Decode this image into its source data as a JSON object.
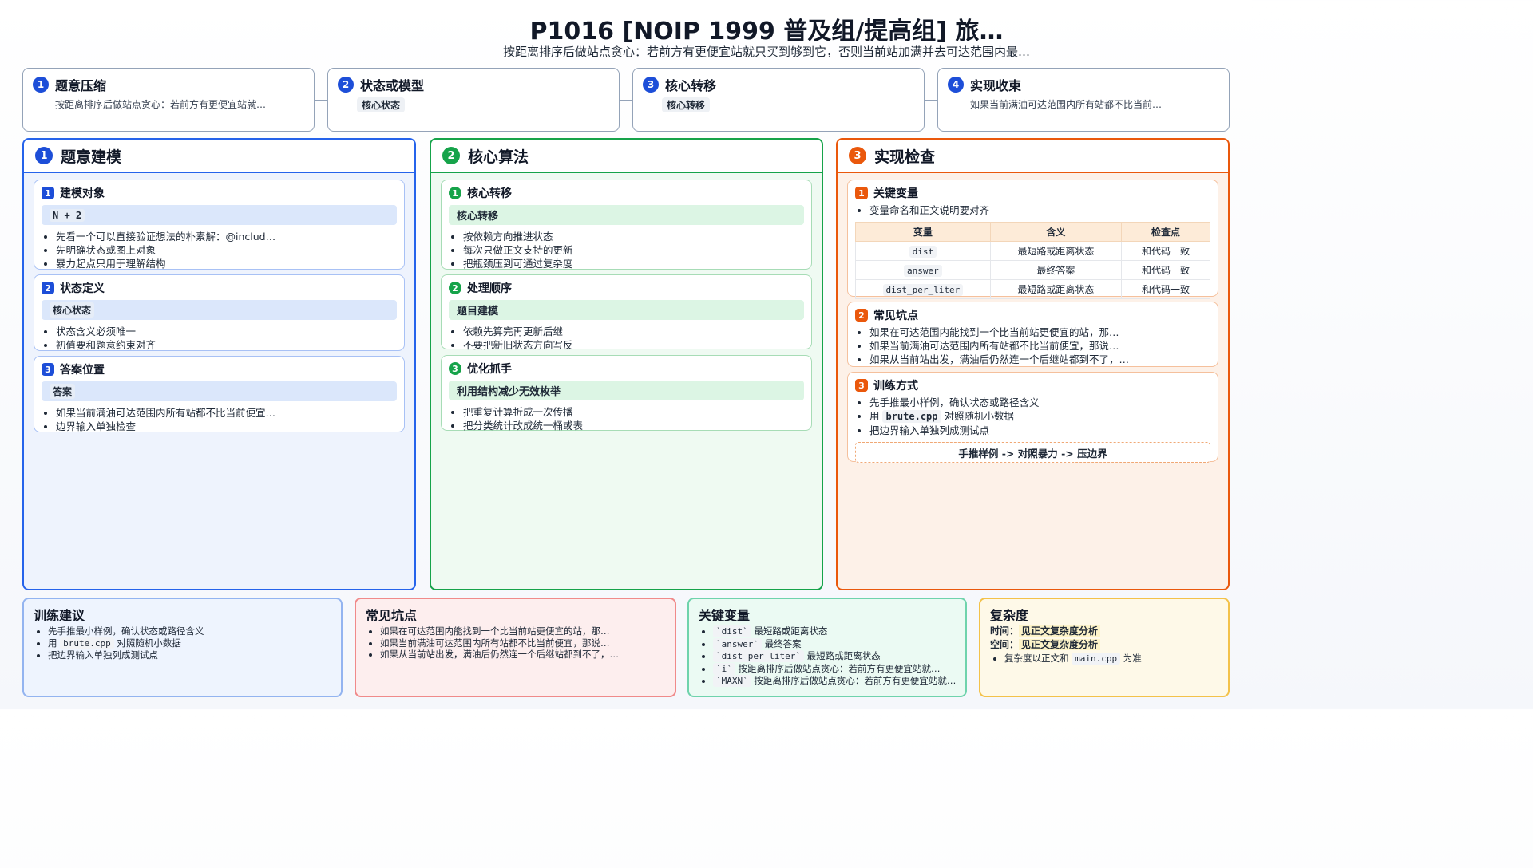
{
  "header": {
    "title": "P1016 [NOIP 1999 普及组/提高组] 旅…",
    "subtitle": "按距离排序后做站点贪心：若前方有更便宜站就只买到够到它，否则当前站加满并去可达范围内最…"
  },
  "steps": [
    {
      "num": "1",
      "title": "题意压缩",
      "desc": "按距离排序后做站点贪心：若前方有更便宜站就…"
    },
    {
      "num": "2",
      "title": "状态或模型",
      "chip": "核心状态"
    },
    {
      "num": "3",
      "title": "核心转移",
      "chip": "核心转移"
    },
    {
      "num": "4",
      "title": "实现收束",
      "desc": "如果当前满油可达范围内所有站都不比当前…"
    }
  ],
  "columns": {
    "modeling": {
      "num": "1",
      "title": "题意建模",
      "cards": [
        {
          "num": "1",
          "title": "建模对象",
          "chip": "N + 2",
          "bullets": [
            "先看一个可以直接验证想法的朴素解：@includ…",
            "先明确状态或图上对象",
            "暴力起点只用于理解结构"
          ]
        },
        {
          "num": "2",
          "title": "状态定义",
          "chip": "核心状态",
          "bullets": [
            "状态含义必须唯一",
            "初值要和题意约束对齐"
          ]
        },
        {
          "num": "3",
          "title": "答案位置",
          "chip": "答案",
          "bullets": [
            "如果当前满油可达范围内所有站都不比当前便宜…",
            "边界输入单独检查"
          ]
        }
      ]
    },
    "algorithm": {
      "num": "2",
      "title": "核心算法",
      "cards": [
        {
          "num": "1",
          "title": "核心转移",
          "chip": "核心转移",
          "bullets": [
            "按依赖方向推进状态",
            "每次只做正文支持的更新",
            "把瓶颈压到可通过复杂度"
          ]
        },
        {
          "num": "2",
          "title": "处理顺序",
          "chip": "题目建模",
          "bullets": [
            "依赖先算完再更新后继",
            "不要把新旧状态方向写反"
          ]
        },
        {
          "num": "3",
          "title": "优化抓手",
          "chip": "利用结构减少无效枚举",
          "bullets": [
            "把重复计算折成一次传播",
            "把分类统计改成统一桶或表"
          ]
        }
      ]
    },
    "implementation": {
      "num": "3",
      "title": "实现检查",
      "vars_card": {
        "num": "1",
        "title": "关键变量",
        "bullet": "变量命名和正文说明要对齐",
        "headers": [
          "变量",
          "含义",
          "检查点"
        ],
        "rows": [
          [
            "dist",
            "最短路或距离状态",
            "和代码一致"
          ],
          [
            "answer",
            "最终答案",
            "和代码一致"
          ],
          [
            "dist_per_liter",
            "最短路或距离状态",
            "和代码一致"
          ]
        ]
      },
      "pitfalls_card": {
        "num": "2",
        "title": "常见坑点",
        "bullets": [
          "如果在可达范围内能找到一个比当前站更便宜的站，那…",
          "如果当前满油可达范围内所有站都不比当前便宜，那说…",
          "如果从当前站出发，满油后仍然连一个后继站都到不了，…"
        ]
      },
      "training_card": {
        "num": "3",
        "title": "训练方式",
        "b1": "先手推最小样例，确认状态或路径含义",
        "b2_pre": "用 ",
        "b2_code": "brute.cpp",
        "b2_post": " 对照随机小数据",
        "b3": "把边界输入单独列成测试点",
        "flow": "手推样例 -> 对照暴力 -> 压边界"
      }
    }
  },
  "bottom": {
    "training": {
      "title": "训练建议",
      "b1": "先手推最小样例，确认状态或路径含义",
      "b2_pre": "用 ",
      "b2_code": "brute.cpp",
      "b2_post": " 对照随机小数据",
      "b3": "把边界输入单独列成测试点"
    },
    "pitfalls": {
      "title": "常见坑点",
      "bullets": [
        "如果在可达范围内能找到一个比当前站更便宜的站，那…",
        "如果当前满油可达范围内所有站都不比当前便宜，那说…",
        "如果从当前站出发，满油后仍然连一个后继站都到不了，…"
      ]
    },
    "key_vars": {
      "title": "关键变量",
      "items": [
        {
          "code": "`dist`",
          "text": "最短路或距离状态"
        },
        {
          "code": "`answer`",
          "text": "最终答案"
        },
        {
          "code": "`dist_per_liter`",
          "text": "最短路或距离状态"
        },
        {
          "code": "`i`",
          "text": "按距离排序后做站点贪心：若前方有更便宜站就…"
        },
        {
          "code": "`MAXN`",
          "text": "按距离排序后做站点贪心：若前方有更便宜站就…"
        }
      ]
    },
    "complexity": {
      "title": "复杂度",
      "time_label": "时间：",
      "time_value": "见正文复杂度分析",
      "space_label": "空间：",
      "space_value": "见正文复杂度分析",
      "note_pre": "复杂度以正文和 ",
      "note_code": "main.cpp",
      "note_post": " 为准"
    }
  },
  "colors": {
    "blue": "#1d4ed8",
    "green": "#16a34a",
    "orange": "#ea580c",
    "red": "#ef4444",
    "teal": "#10b981",
    "amber": "#f59e0b"
  }
}
